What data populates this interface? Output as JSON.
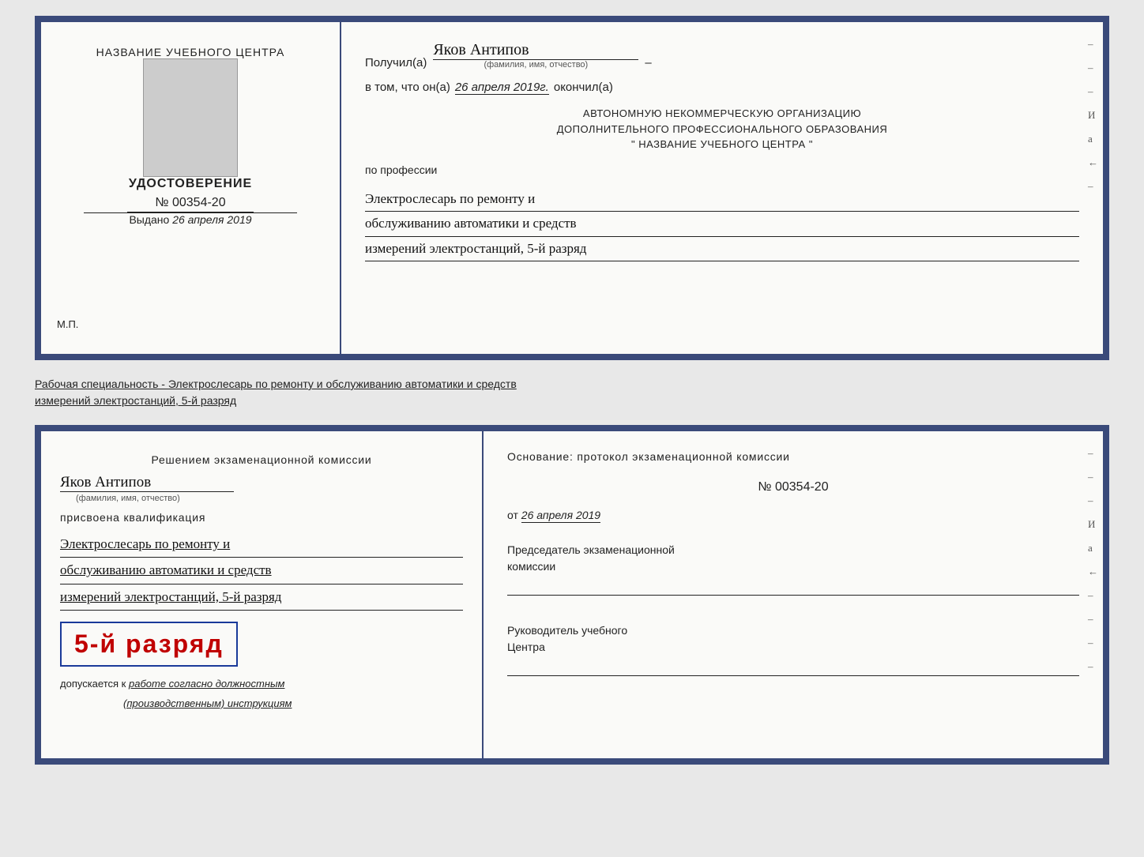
{
  "top_diploma": {
    "left": {
      "org_name": "НАЗВАНИЕ УЧЕБНОГО ЦЕНТРА",
      "udostoverenie_label": "УДОСТОВЕРЕНИЕ",
      "number": "№ 00354-20",
      "vydano_label": "Выдано",
      "vydano_date": "26 апреля 2019",
      "mp_label": "М.П."
    },
    "right": {
      "poluchil_label": "Получил(а)",
      "recipient_name": "Яков Антипов",
      "fio_sublabel": "(фамилия, имя, отчество)",
      "vtom_label": "в том, что он(а)",
      "vtom_date": "26 апреля 2019г.",
      "okoncil_label": "окончил(а)",
      "org_line1": "АВТОНОМНУЮ НЕКОММЕРЧЕСКУЮ ОРГАНИЗАЦИЮ",
      "org_line2": "ДОПОЛНИТЕЛЬНОГО ПРОФЕССИОНАЛЬНОГО ОБРАЗОВАНИЯ",
      "org_line3": "\" НАЗВАНИЕ УЧЕБНОГО ЦЕНТРА \"",
      "po_professii_label": "по профессии",
      "profession_line1": "Электрослесарь по ремонту и",
      "profession_line2": "обслуживанию автоматики и средств",
      "profession_line3": "измерений электростанций, 5-й разряд"
    },
    "side_dashes": [
      "–",
      "–",
      "–",
      "И",
      "а",
      "←",
      "–"
    ]
  },
  "middle_label": {
    "text": "Рабочая специальность - Электрослесарь по ремонту и обслуживанию автоматики и средств",
    "text2": "измерений электростанций, 5-й разряд"
  },
  "qual_card": {
    "left": {
      "resheniem_label": "Решением экзаменационной комиссии",
      "name_cursive": "Яков Антипов",
      "fio_sublabel": "(фамилия, имя, отчество)",
      "prisvoena_label": "присвоена квалификация",
      "qual_line1": "Электрослесарь по ремонту и",
      "qual_line2": "обслуживанию автоматики и средств",
      "qual_line3": "измерений электростанций, 5-й разряд",
      "razryad_badge": "5-й разряд",
      "dopuskaetsya_label": "допускается к",
      "dopuskaetsya_cursive": "работе согласно должностным",
      "dopuskaetsya_cursive2": "(производственным) инструкциям"
    },
    "right": {
      "osnovanie_label": "Основание: протокол экзаменационной комиссии",
      "proto_number": "№ 00354-20",
      "ot_label": "от",
      "ot_date": "26 апреля 2019",
      "chairman_label": "Председатель экзаменационной",
      "chairman_label2": "комиссии",
      "rukovod_label": "Руководитель учебного",
      "rukovod_label2": "Центра"
    },
    "side_dashes": [
      "–",
      "–",
      "–",
      "И",
      "а",
      "←",
      "–",
      "–",
      "–",
      "–"
    ]
  }
}
